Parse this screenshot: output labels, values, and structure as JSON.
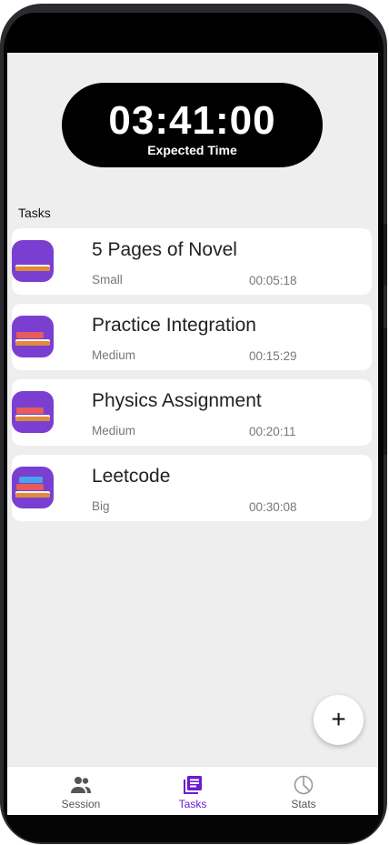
{
  "timer": {
    "value": "03:41:00",
    "caption": "Expected Time"
  },
  "section": {
    "title": "Tasks"
  },
  "tasks": [
    {
      "title": "5 Pages of Novel",
      "size": "Small",
      "time": "00:05:18"
    },
    {
      "title": "Practice Integration",
      "size": "Medium",
      "time": "00:15:29"
    },
    {
      "title": "Physics Assignment",
      "size": "Medium",
      "time": "00:20:11"
    },
    {
      "title": "Leetcode",
      "size": "Big",
      "time": "00:30:08"
    }
  ],
  "fab": {
    "label": "+"
  },
  "nav": {
    "items": [
      {
        "label": "Session",
        "icon": "people-icon"
      },
      {
        "label": "Tasks",
        "icon": "list-icon",
        "active": true
      },
      {
        "label": "Stats",
        "icon": "pie-chart-icon"
      }
    ]
  },
  "colors": {
    "accent": "#6a1bd1",
    "task_icon_bg": "#7a3fd1",
    "screen_bg": "#efeeee"
  }
}
